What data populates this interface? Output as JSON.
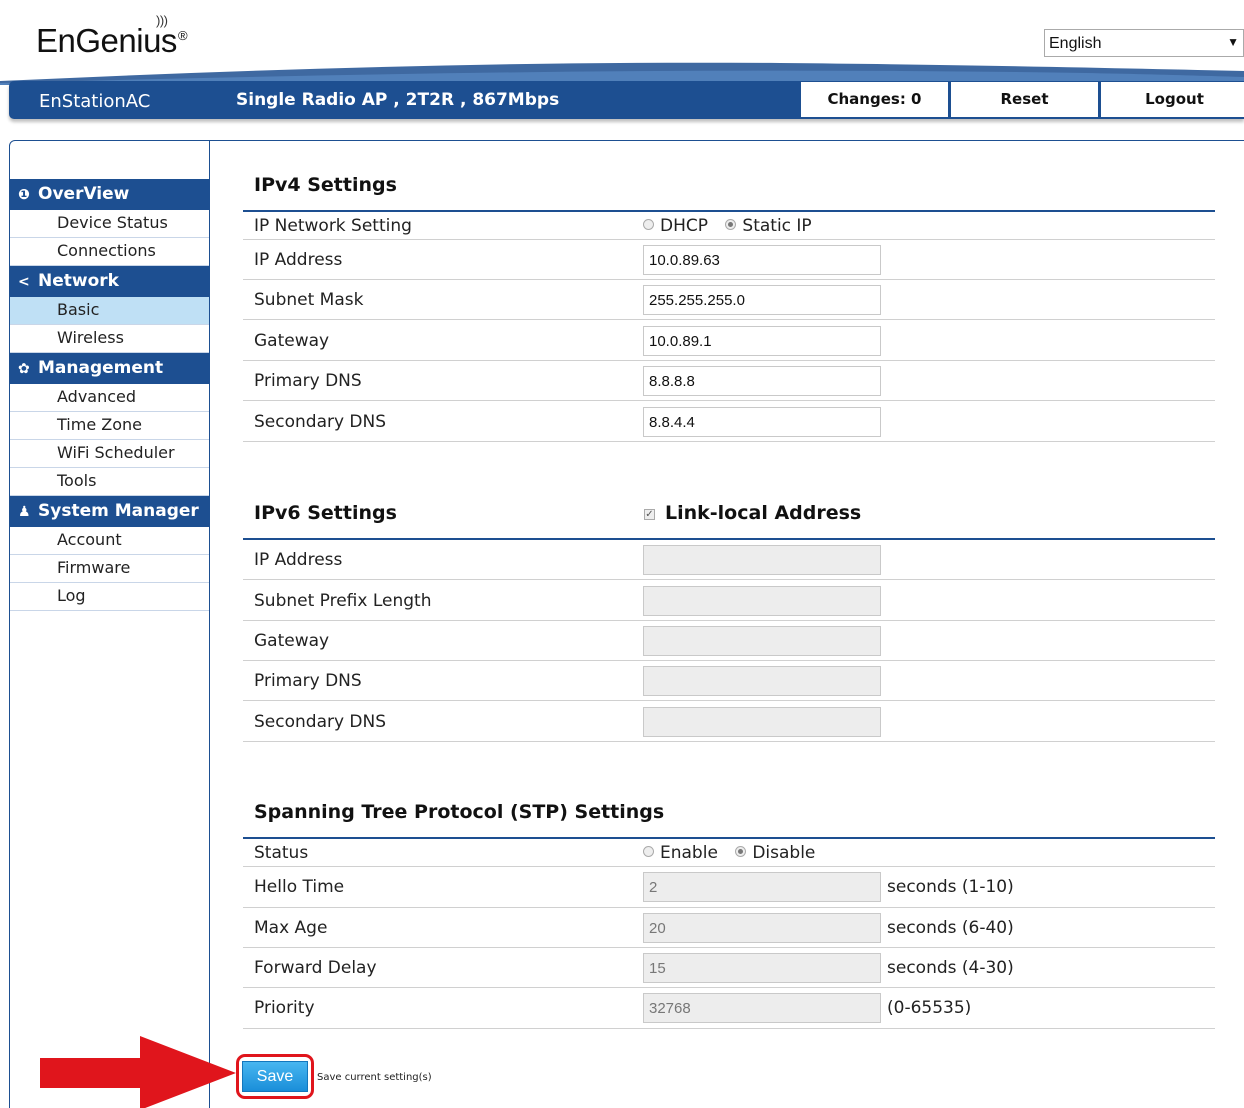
{
  "brand": {
    "logo_text": "EnGenius"
  },
  "language": {
    "selected": "English"
  },
  "header": {
    "model_name": "EnStationAC",
    "model_desc": "Single Radio AP , 2T2R , 867Mbps",
    "changes_label": "Changes: 0",
    "reset_label": "Reset",
    "logout_label": "Logout"
  },
  "sidebar": {
    "overview": {
      "label": "OverView",
      "items": [
        "Device Status",
        "Connections"
      ]
    },
    "network": {
      "label": "Network",
      "items": [
        "Basic",
        "Wireless"
      ],
      "active": "Basic"
    },
    "management": {
      "label": "Management",
      "items": [
        "Advanced",
        "Time Zone",
        "WiFi Scheduler",
        "Tools"
      ]
    },
    "system_manager": {
      "label": "System Manager",
      "items": [
        "Account",
        "Firmware",
        "Log"
      ]
    }
  },
  "ipv4": {
    "title": "IPv4 Settings",
    "network_setting_label": "IP Network Setting",
    "options": [
      "DHCP",
      "Static IP"
    ],
    "selected": "Static IP",
    "ip_address_label": "IP Address",
    "ip_address": "10.0.89.63",
    "subnet_mask_label": "Subnet Mask",
    "subnet_mask": "255.255.255.0",
    "gateway_label": "Gateway",
    "gateway": "10.0.89.1",
    "primary_dns_label": "Primary DNS",
    "primary_dns": "8.8.8.8",
    "secondary_dns_label": "Secondary DNS",
    "secondary_dns": "8.8.4.4"
  },
  "ipv6": {
    "title": "IPv6 Settings",
    "link_local_label": "Link-local Address",
    "link_local_checked": true,
    "ip_address_label": "IP Address",
    "prefix_length_label": "Subnet Prefix Length",
    "gateway_label": "Gateway",
    "primary_dns_label": "Primary DNS",
    "secondary_dns_label": "Secondary DNS"
  },
  "stp": {
    "title": "Spanning Tree Protocol (STP) Settings",
    "status_label": "Status",
    "options": [
      "Enable",
      "Disable"
    ],
    "selected": "Disable",
    "hello_time_label": "Hello Time",
    "hello_time": "2",
    "hello_time_unit": "seconds (1-10)",
    "max_age_label": "Max Age",
    "max_age": "20",
    "max_age_unit": "seconds (6-40)",
    "forward_delay_label": "Forward Delay",
    "forward_delay": "15",
    "forward_delay_unit": "seconds (4-30)",
    "priority_label": "Priority",
    "priority": "32768",
    "priority_unit": "(0-65535)"
  },
  "footer": {
    "save_label": "Save",
    "save_hint": "Save current setting(s)"
  },
  "colors": {
    "brand_blue": "#1d4f91",
    "active_item": "#bfe0f5",
    "highlight_red": "#e0151c",
    "save_blue": "#2a9fe4"
  }
}
